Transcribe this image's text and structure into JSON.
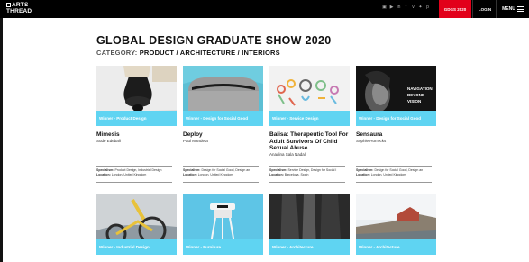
{
  "header": {
    "logo_line1": "ARTS",
    "logo_line2": "THREAD",
    "gdgs_label": "GDGS 2020",
    "login_label": "LOGIN",
    "menu_label": "MENU",
    "social_icons": [
      "instagram-icon",
      "youtube-icon",
      "linkedin-icon",
      "facebook-icon",
      "vimeo-icon",
      "twitter-icon",
      "pinterest-icon"
    ]
  },
  "page": {
    "title": "GLOBAL DESIGN GRADUATE SHOW 2020",
    "category_label": "CATEGORY:",
    "category_value": "PRODUCT / ARCHITECTURE / INTERIORS"
  },
  "specialism_label": "Specialism:",
  "location_label": "Location:",
  "accent_color": "#5fd4f2",
  "brand_red": "#e2001a",
  "cards": [
    {
      "award": "Winner - Product Design",
      "name": "Mimesis",
      "author": "Sude Edebali",
      "specialism": "Product Design, Industrial Design",
      "location": "London, United Kingdom"
    },
    {
      "award": "Winner - Design for Social Good",
      "name": "Deploy",
      "author": "Paul Mandeta",
      "specialism": "Design for Social Good, Design an",
      "location": "London, United Kingdom"
    },
    {
      "award": "Winner - Service Design",
      "name": "Balisa: Therapeutic Tool For Adult Survivors Of Child Sexual Abuse",
      "author": "Anadina Sala Nadal",
      "specialism": "Service Design, Design for Social I",
      "location": "Barcelona, Spain"
    },
    {
      "award": "Winner - Design for Social Good",
      "name": "Sensaura",
      "author": "Sophie Horrocks",
      "specialism": "Design for Social Good, Design an",
      "location": "London, United Kingdom",
      "thumb_text": [
        "NAVIGATION",
        "BEYOND",
        "VISION"
      ]
    },
    {
      "award": "Winner - Industrial Design",
      "name": "",
      "author": ""
    },
    {
      "award": "Winner - Furniture",
      "name": "",
      "author": ""
    },
    {
      "award": "Winner - Architecture",
      "name": "",
      "author": ""
    },
    {
      "award": "Winner - Architecture",
      "name": "",
      "author": ""
    }
  ]
}
